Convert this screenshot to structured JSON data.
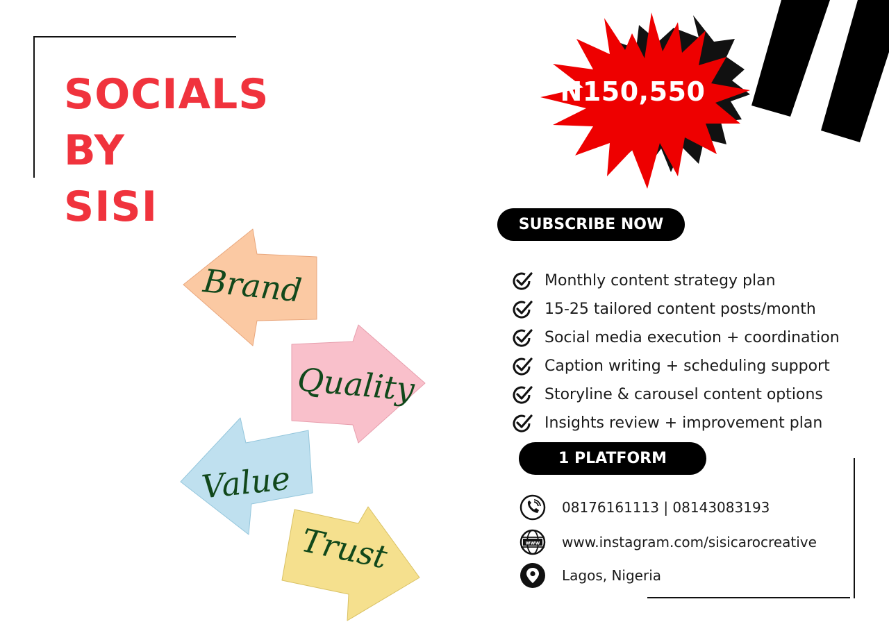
{
  "brand": {
    "title_lines": [
      "SOCIALS",
      "BY",
      "SISI"
    ],
    "accent_color": "#f0333d"
  },
  "price": {
    "label": "N150,550",
    "burst_color": "#ee0000"
  },
  "cta": {
    "subscribe_label": "SUBSCRIBE NOW",
    "platform_label": "1 PLATFORM"
  },
  "features": [
    "Monthly content strategy plan",
    "15-25 tailored content posts/month",
    "Social media execution + coordination",
    "Caption writing + scheduling support",
    "Storyline & carousel content options",
    "Insights review + improvement plan"
  ],
  "contact": {
    "phone": "08176161113 | 08143083193",
    "website": "www.instagram.com/sisicarocreative",
    "location": "Lagos,  Nigeria",
    "icons": [
      "phone-icon",
      "globe-www-icon",
      "location-pin-icon"
    ]
  },
  "sticky_notes": [
    {
      "label": "Brand",
      "color": "#fbc9a3",
      "direction": "left"
    },
    {
      "label": "Quality",
      "color": "#f9c0cb",
      "direction": "right"
    },
    {
      "label": "Value",
      "color": "#bfe0ef",
      "direction": "left"
    },
    {
      "label": "Trust",
      "color": "#f5e08e",
      "direction": "right"
    }
  ]
}
